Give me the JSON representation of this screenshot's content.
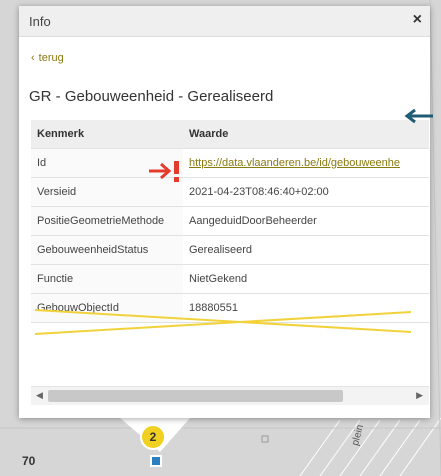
{
  "popup": {
    "title": "Info",
    "close_glyph": "×",
    "back_label": "terug",
    "feature_title": "GR - Gebouweenheid - Gerealiseerd",
    "accent_color": "#8a7a10"
  },
  "table": {
    "headers": [
      "Kenmerk",
      "Waarde"
    ],
    "rows": [
      {
        "key": "Id",
        "value": "https://data.vlaanderen.be/id/gebouweenhe"
      },
      {
        "key": "Versieid",
        "value": "2021-04-23T08:46:40+02:00"
      },
      {
        "key": "PositieGeometrieMethode",
        "value": "AangeduidDoorBeheerder"
      },
      {
        "key": "GebouweenheidStatus",
        "value": "Gerealiseerd"
      },
      {
        "key": "Functie",
        "value": "NietGekend"
      },
      {
        "key": "GebouwObjectId",
        "value": "18880551"
      }
    ]
  },
  "annotations": {
    "red_arrow_color": "#e53b2c",
    "blue_arrow_color": "#1f5c74",
    "strike_color": "#f2d23a"
  },
  "map": {
    "number_label": "70",
    "street_label": "plein",
    "marker_count": "2"
  }
}
